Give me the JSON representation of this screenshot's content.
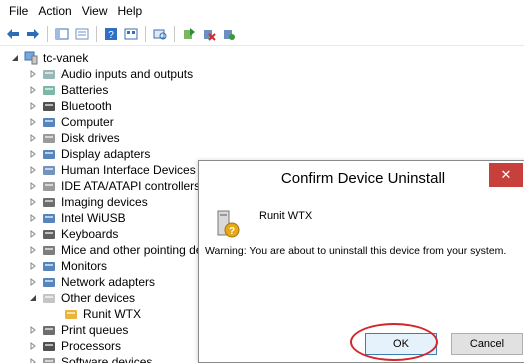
{
  "menu": [
    "File",
    "Action",
    "View",
    "Help"
  ],
  "tree": {
    "root": "tc-vanek",
    "items": [
      {
        "label": "Audio inputs and outputs",
        "expanded": false
      },
      {
        "label": "Batteries",
        "expanded": false
      },
      {
        "label": "Bluetooth",
        "expanded": false
      },
      {
        "label": "Computer",
        "expanded": false
      },
      {
        "label": "Disk drives",
        "expanded": false
      },
      {
        "label": "Display adapters",
        "expanded": false
      },
      {
        "label": "Human Interface Devices",
        "expanded": false
      },
      {
        "label": "IDE ATA/ATAPI controllers",
        "expanded": false
      },
      {
        "label": "Imaging devices",
        "expanded": false
      },
      {
        "label": "Intel WiUSB",
        "expanded": false
      },
      {
        "label": "Keyboards",
        "expanded": false
      },
      {
        "label": "Mice and other pointing dev",
        "expanded": false
      },
      {
        "label": "Monitors",
        "expanded": false
      },
      {
        "label": "Network adapters",
        "expanded": false
      },
      {
        "label": "Other devices",
        "expanded": true
      },
      {
        "label": "Runit WTX",
        "child": true
      },
      {
        "label": "Print queues",
        "expanded": false
      },
      {
        "label": "Processors",
        "expanded": false
      },
      {
        "label": "Software devices",
        "expanded": false
      }
    ]
  },
  "dialog": {
    "title": "Confirm Device Uninstall",
    "close_glyph": "✕",
    "device_name": "Runit WTX",
    "warning": "Warning: You are about to uninstall this device from your system.",
    "ok_label": "OK",
    "cancel_label": "Cancel"
  },
  "colors": {
    "close_button": "#c7403c",
    "highlight_circle": "#d4252a",
    "ok_border": "#3c7fb1"
  }
}
